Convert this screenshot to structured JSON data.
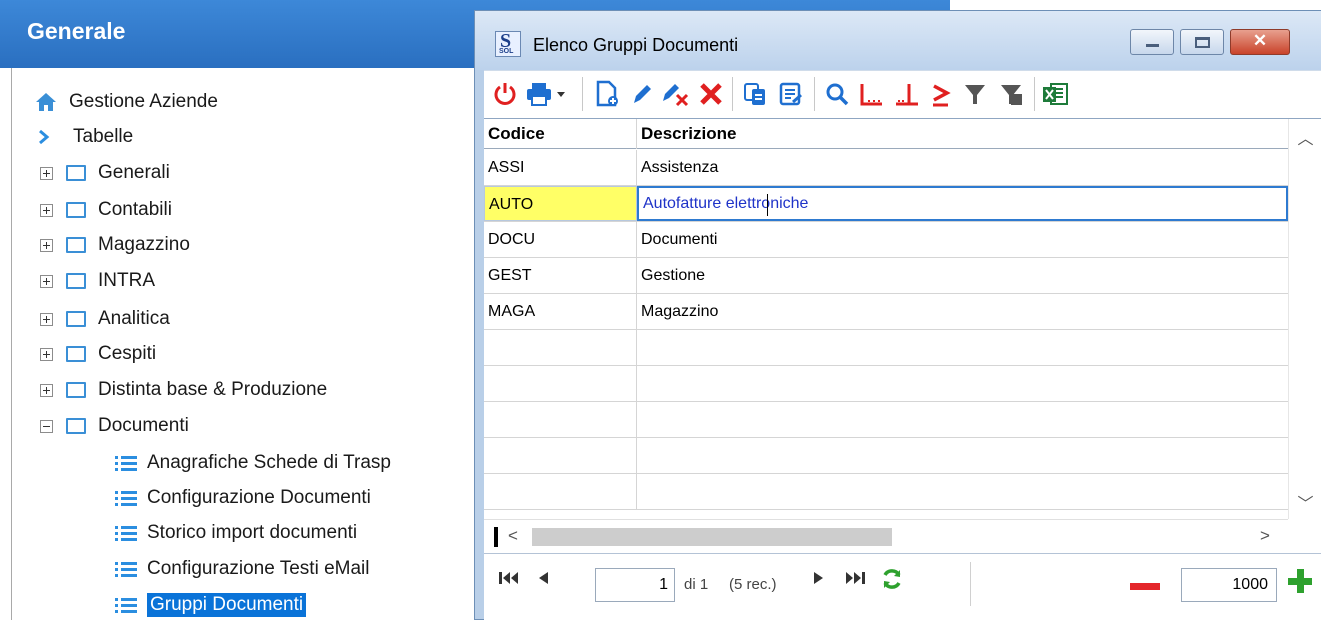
{
  "left_panel": {
    "title": "Generale",
    "items": [
      {
        "label": "Gestione Aziende",
        "type": "home"
      },
      {
        "label": "Tabelle",
        "type": "chevron"
      },
      {
        "label": "Generali",
        "type": "folder",
        "expanded": false
      },
      {
        "label": "Contabili",
        "type": "folder",
        "expanded": false
      },
      {
        "label": "Magazzino",
        "type": "folder",
        "expanded": false
      },
      {
        "label": "INTRA",
        "type": "folder",
        "expanded": false
      },
      {
        "label": "Analitica",
        "type": "folder",
        "expanded": false
      },
      {
        "label": "Cespiti",
        "type": "folder",
        "expanded": false
      },
      {
        "label": "Distinta base & Produzione",
        "type": "folder",
        "expanded": false
      },
      {
        "label": "Documenti",
        "type": "folder",
        "expanded": true
      },
      {
        "label": "Anagrafiche Schede di Trasp",
        "type": "list"
      },
      {
        "label": "Configurazione Documenti",
        "type": "list"
      },
      {
        "label": "Storico import documenti",
        "type": "list"
      },
      {
        "label": "Configurazione Testi eMail",
        "type": "list"
      },
      {
        "label": "Gruppi Documenti",
        "type": "list",
        "selected": true
      }
    ]
  },
  "dialog": {
    "title": "Elenco Gruppi Documenti",
    "app_icon": {
      "letter": "S",
      "sub": "SOL"
    },
    "window_buttons": {
      "close": "✕"
    },
    "toolbar": [
      {
        "name": "power-icon",
        "color": "#e02020"
      },
      {
        "name": "print-icon",
        "color": "#1f6fd0"
      },
      {
        "name": "new-document-icon",
        "color": "#1f6fd0"
      },
      {
        "name": "edit-pencil-icon",
        "color": "#1f6fd0"
      },
      {
        "name": "clear-edit-icon",
        "color": "#1f6fd0"
      },
      {
        "name": "delete-icon",
        "color": "#e02020"
      },
      {
        "name": "copy-icon",
        "color": "#1f6fd0"
      },
      {
        "name": "details-icon",
        "color": "#1f6fd0"
      },
      {
        "name": "search-icon",
        "color": "#1f6fd0"
      },
      {
        "name": "bookmark-start-icon",
        "color": "#e02020"
      },
      {
        "name": "bookmark-end-icon",
        "color": "#e02020"
      },
      {
        "name": "sum-icon",
        "color": "#e02020"
      },
      {
        "name": "filter-icon",
        "color": "#555555"
      },
      {
        "name": "clear-filter-icon",
        "color": "#555555"
      },
      {
        "name": "excel-export-icon",
        "color": "#1e7b3a"
      }
    ],
    "grid": {
      "columns": [
        "Codice",
        "Descrizione"
      ],
      "rows": [
        {
          "code": "ASSI",
          "description": "Assistenza"
        },
        {
          "code": "AUTO",
          "description": "Autofatture elettroniche",
          "active": true
        },
        {
          "code": "DOCU",
          "description": "Documenti"
        },
        {
          "code": "GEST",
          "description": "Gestione"
        },
        {
          "code": "MAGA",
          "description": "Magazzino"
        },
        {
          "code": "",
          "description": ""
        },
        {
          "code": "",
          "description": ""
        },
        {
          "code": "",
          "description": ""
        },
        {
          "code": "",
          "description": ""
        },
        {
          "code": "",
          "description": ""
        }
      ]
    },
    "navigator": {
      "page": "1",
      "of_label": "di 1",
      "records_label": "(5 rec.)",
      "zoom_value": "1000"
    }
  }
}
